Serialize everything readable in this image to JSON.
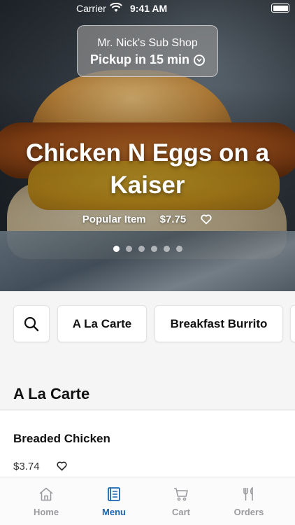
{
  "status_bar": {
    "carrier": "Carrier",
    "time": "9:41 AM"
  },
  "store": {
    "name": "Mr. Nick's Sub Shop",
    "pickup": "Pickup in 15 min"
  },
  "hero": {
    "title": "Chicken N Eggs on a Kaiser",
    "badge": "Popular Item",
    "price": "$7.75",
    "slides_total": 6,
    "active_slide": 0
  },
  "categories": {
    "search_icon": "search-icon",
    "chips": [
      "A La Carte",
      "Breakfast Burrito"
    ]
  },
  "section": {
    "title": "A La Carte"
  },
  "items": [
    {
      "name": "Breaded Chicken",
      "price": "$3.74"
    }
  ],
  "tabs": [
    {
      "label": "Home",
      "icon": "home-icon",
      "active": false
    },
    {
      "label": "Menu",
      "icon": "menu-book-icon",
      "active": true
    },
    {
      "label": "Cart",
      "icon": "cart-icon",
      "active": false
    },
    {
      "label": "Orders",
      "icon": "fork-knife-icon",
      "active": false
    }
  ],
  "colors": {
    "accent": "#1b67b1",
    "inactive_tab": "#9a9a9f"
  }
}
